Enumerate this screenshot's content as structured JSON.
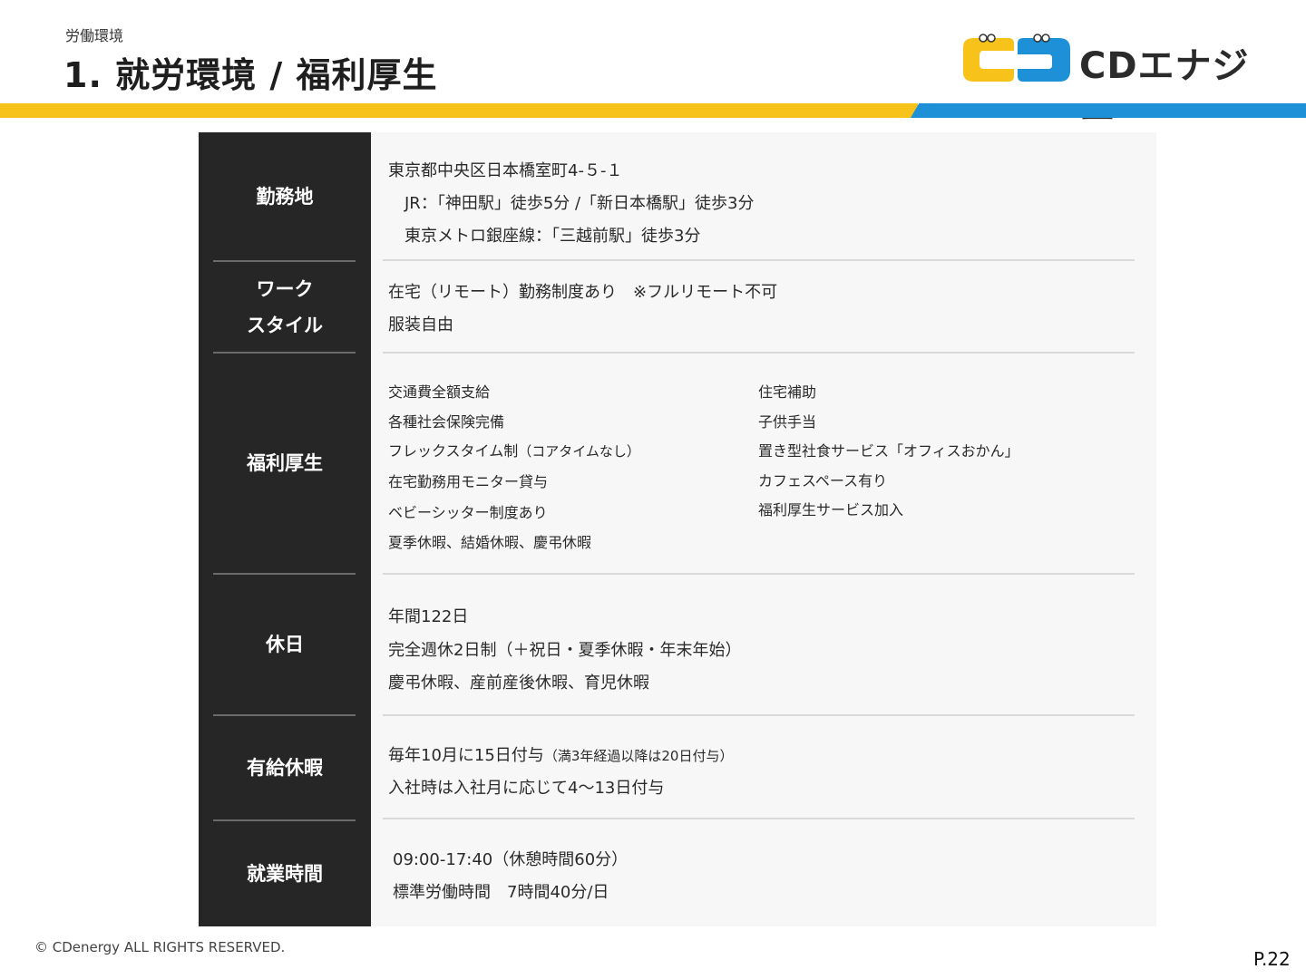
{
  "header": {
    "section_label": "労働環境",
    "title": "1. 就労環境 / 福利厚生"
  },
  "logo": {
    "text": "CDエナジー",
    "colors": {
      "yellow": "#f7c21a",
      "blue": "#1e90d8"
    }
  },
  "stripe_colors": {
    "yellow": "#f7c21a",
    "blue": "#1e90d8"
  },
  "rows": [
    {
      "label": [
        "勤務地"
      ],
      "lines": [
        "東京都中央区日本橋室町4-５-１",
        "　JR：「神田駅」徒歩5分 /「新日本橋駅」徒歩3分",
        "　東京メトロ銀座線：「三越前駅」徒歩3分"
      ]
    },
    {
      "label": [
        "ワーク",
        "スタイル"
      ],
      "lines": [
        "在宅（リモート）勤務制度あり　※フルリモート不可",
        "服装自由"
      ]
    },
    {
      "label": [
        "福利厚生"
      ],
      "left": [
        "交通費全額支給",
        "各種社会保険完備",
        "フレックスタイム制",
        "在宅勤務用モニター貸与",
        "ベビーシッター制度あり",
        "夏季休暇、結婚休暇、慶弔休暇"
      ],
      "left_note": "（コアタイムなし）",
      "right": [
        "住宅補助",
        "子供手当",
        "置き型社食サービス「オフィスおかん」",
        "カフェスペース有り",
        "福利厚生サービス加入"
      ]
    },
    {
      "label": [
        "休日"
      ],
      "lines": [
        "年間122日",
        "完全週休2日制（＋祝日・夏季休暇・年末年始）",
        "慶弔休暇、産前産後休暇、育児休暇"
      ]
    },
    {
      "label": [
        "有給休暇"
      ],
      "lines": [
        "毎年10月に15日付与",
        "入社時は入社月に応じて4〜13日付与"
      ],
      "note": "（満3年経過以降は20日付与）"
    },
    {
      "label": [
        "就業時間"
      ],
      "lines": [
        "09:00-17:40（休憩時間60分）",
        "標準労働時間　7時間40分/日"
      ]
    }
  ],
  "footer": {
    "copyright": "© CDenergy ALL RIGHTS RESERVED.",
    "page": "P.22"
  }
}
